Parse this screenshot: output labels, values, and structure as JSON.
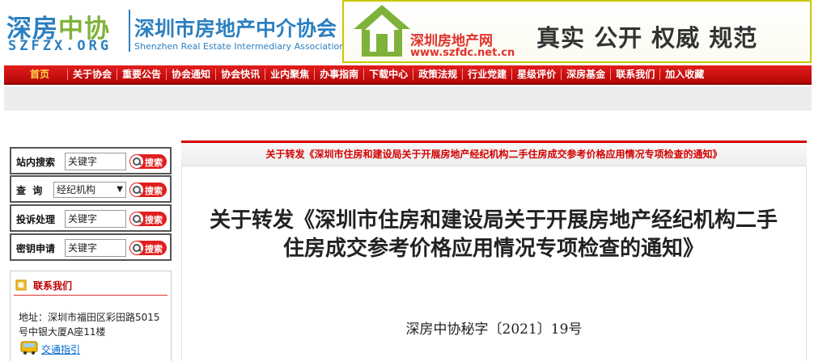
{
  "header": {
    "logo_main_a": "深房",
    "logo_main_b": "中协",
    "logo_sub": "SZFZX.ORG",
    "assoc_name": "深圳市房地产中介协会",
    "assoc_name_en": "Shenzhen Real Estate Intermediary Association",
    "banner_site_name": "深圳房地产网",
    "banner_site_url": "www.szfdc.net.cn",
    "slogan": "真实 公开 权威 规范",
    "colors": {
      "brand_blue": "#2c7fc0",
      "brand_green": "#7fb23a",
      "accent_red": "#e0312a"
    }
  },
  "nav": {
    "items": [
      {
        "label": "首页",
        "active": true
      },
      {
        "label": "关于协会"
      },
      {
        "label": "重要公告"
      },
      {
        "label": "协会通知"
      },
      {
        "label": "协会快讯"
      },
      {
        "label": "业内聚焦"
      },
      {
        "label": "办事指南"
      },
      {
        "label": "下载中心"
      },
      {
        "label": "政策法规"
      },
      {
        "label": "行业党建"
      },
      {
        "label": "星级评价"
      },
      {
        "label": "深房基金"
      },
      {
        "label": "联系我们"
      },
      {
        "label": "加入收藏"
      }
    ]
  },
  "sidebar": {
    "site_search": {
      "label": "站内搜索",
      "value": "关键字",
      "button": "搜索"
    },
    "query": {
      "label": "查  询",
      "selected": "经纪机构",
      "button": "搜索"
    },
    "complaint": {
      "label": "投诉处理",
      "value": "关键字",
      "button": "搜索"
    },
    "key_apply": {
      "label": "密钥申请",
      "value": "关键字",
      "button": "搜索"
    },
    "contact": {
      "title": "联系我们",
      "address": "地址：深圳市福田区彩田路5015号中银大厦A座11楼",
      "traffic_link": "交通指引"
    }
  },
  "main": {
    "breadcrumb": "关于转发《深圳市住房和建设局关于开展房地产经纪机构二手住房成交参考价格应用情况专项检查的通知》",
    "article_title": "关于转发《深圳市住房和建设局关于开展房地产经纪机构二手住房成交参考价格应用情况专项检查的通知》",
    "doc_number": "深房中协秘字〔2021〕19号"
  }
}
